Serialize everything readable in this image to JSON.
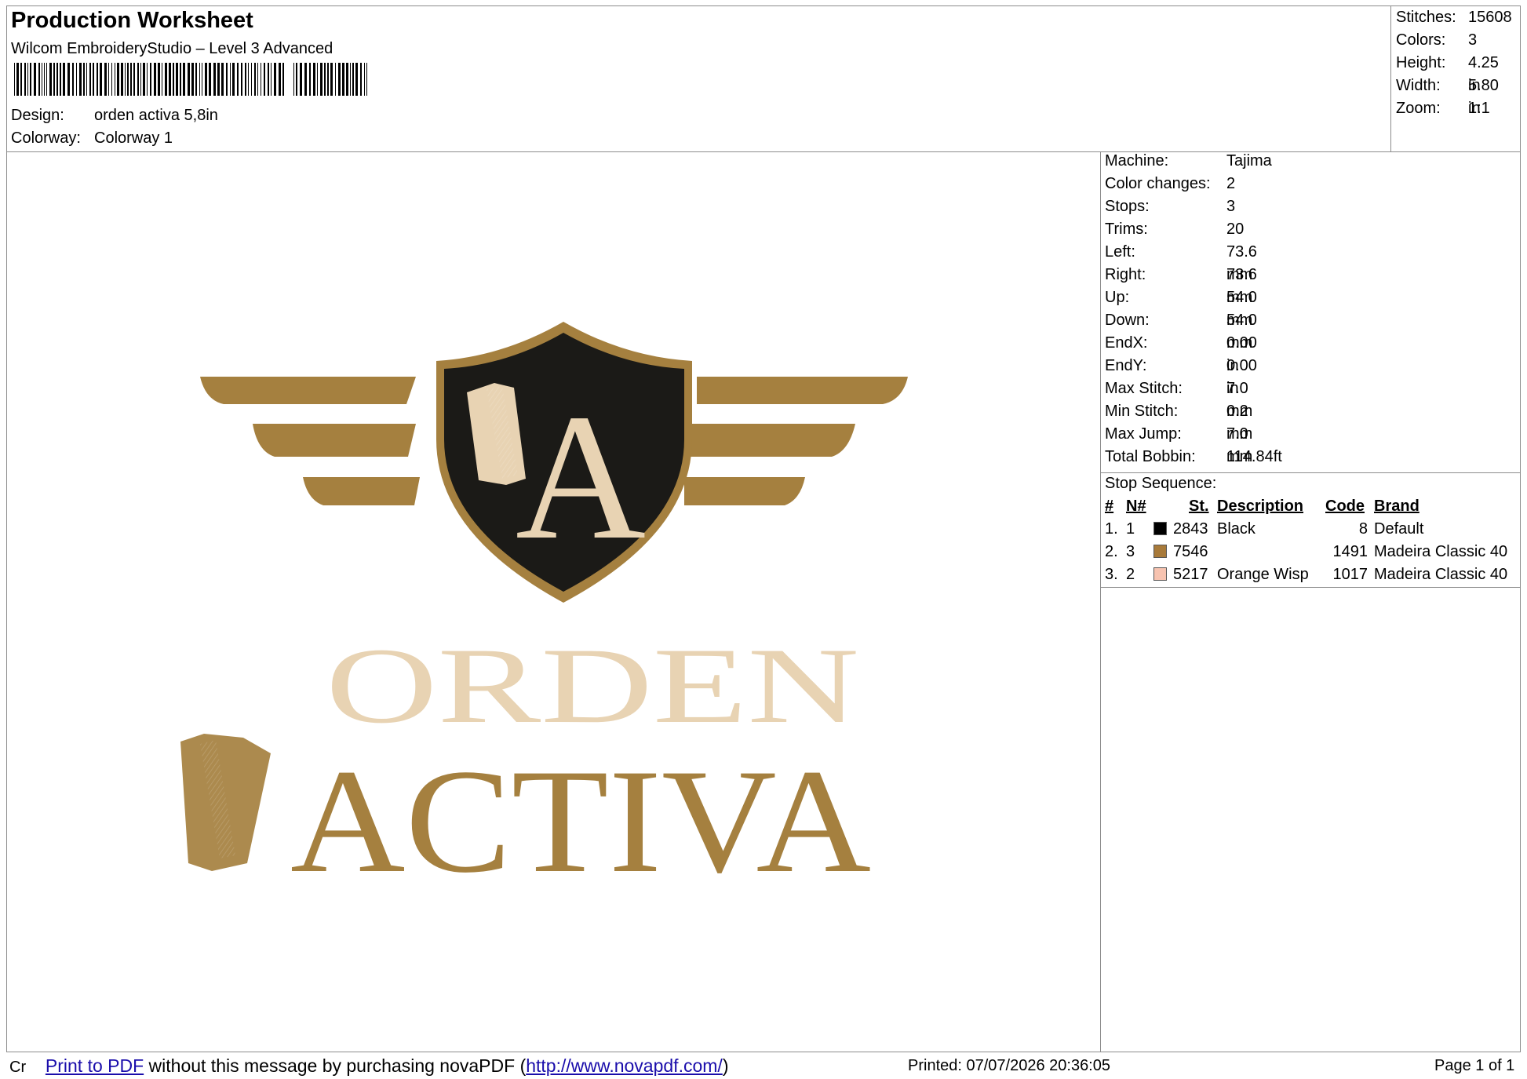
{
  "header": {
    "title": "Production Worksheet",
    "subtitle": "Wilcom EmbroideryStudio – Level 3 Advanced",
    "barcode_char": ",",
    "design_label": "Design:",
    "design_value": "orden activa 5,8in",
    "colorway_label": "Colorway:",
    "colorway_value": "Colorway 1"
  },
  "summary": [
    {
      "label": "Stitches:",
      "value": "15608"
    },
    {
      "label": "Colors:",
      "value": "3"
    },
    {
      "label": "Height:",
      "value": "4.25 in"
    },
    {
      "label": "Width:",
      "value": "5.80 in"
    },
    {
      "label": "Zoom:",
      "value": "1:1"
    }
  ],
  "machine_info": [
    {
      "label": "Machine:",
      "value": "Tajima"
    },
    {
      "label": "Color changes:",
      "value": "2"
    },
    {
      "label": "Stops:",
      "value": "3"
    },
    {
      "label": "Trims:",
      "value": "20"
    },
    {
      "label": "Left:",
      "value": "73.6 mm"
    },
    {
      "label": "Right:",
      "value": "73.6 mm"
    },
    {
      "label": "Up:",
      "value": "54.0 mm"
    },
    {
      "label": "Down:",
      "value": "54.0 mm"
    },
    {
      "label": "EndX:",
      "value": "0.00 in"
    },
    {
      "label": "EndY:",
      "value": "0.00 in"
    },
    {
      "label": "Max Stitch:",
      "value": "7.0 mm"
    },
    {
      "label": "Min Stitch:",
      "value": "0.2 mm"
    },
    {
      "label": "Max Jump:",
      "value": "7.0 mm"
    },
    {
      "label": "Total Bobbin:",
      "value": "114.84ft"
    }
  ],
  "stop_sequence": {
    "title": "Stop Sequence:",
    "headers": {
      "num": "#",
      "n": "N#",
      "st": "St.",
      "description": "Description",
      "code": "Code",
      "brand": "Brand"
    },
    "rows": [
      {
        "num": "1.",
        "n": "1",
        "color": "#000000",
        "st": "2843",
        "description": "Black",
        "code": "8",
        "brand": "Default"
      },
      {
        "num": "2.",
        "n": "3",
        "color": "#a87a3a",
        "st": "7546",
        "description": "",
        "code": "1491",
        "brand": "Madeira Classic 40"
      },
      {
        "num": "3.",
        "n": "2",
        "color": "#f7c3b0",
        "st": "5217",
        "description": "Orange Wisp",
        "code": "1017",
        "brand": "Madeira Classic 40"
      }
    ]
  },
  "logo": {
    "monogram": "A",
    "line1": "ORDEN",
    "line2": "ACTIVA",
    "colors": {
      "gold": "#a5803f",
      "cream": "#e8d3b3",
      "black": "#1b1a17"
    }
  },
  "footer": {
    "prefix": "Cr",
    "link1": "Print to PDF",
    "text1": " without this message by purchasing novaPDF (",
    "link2": "http://www.novapdf.com/",
    "text2": ")",
    "printed": "Printed: 07/07/2026 20:36:05",
    "page": "Page 1 of 1"
  }
}
